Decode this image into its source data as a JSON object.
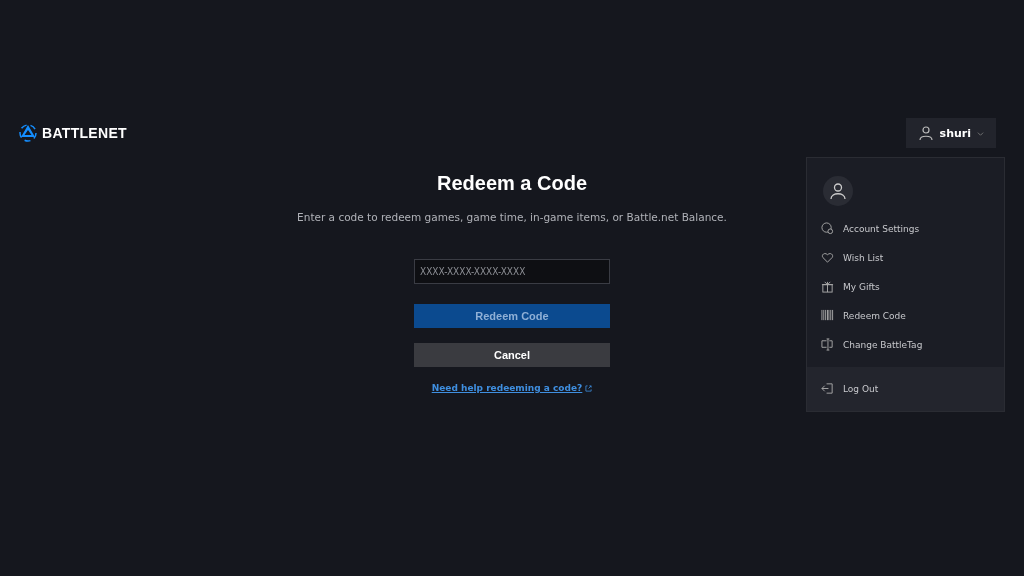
{
  "header": {
    "logo": "BATTLENET",
    "user": {
      "name": "shuri"
    }
  },
  "main": {
    "title": "Redeem a Code",
    "subtitle": "Enter a code to redeem games, game time, in-game items, or Battle.net Balance.",
    "code_field": {
      "placeholder": "XXXX-XXXX-XXXX-XXXX"
    },
    "redeem_button": {
      "label": "Redeem Code",
      "disabled": true
    },
    "cancel_button": {
      "label": "Cancel"
    },
    "help_link": "Need help redeeming a code?"
  },
  "user_menu": {
    "items": [
      {
        "label": "Account Settings",
        "kind": "settings"
      },
      {
        "label": "Wish List",
        "kind": "wishlist"
      },
      {
        "label": "My Gifts",
        "kind": "gifts"
      },
      {
        "label": "Redeem Code",
        "kind": "redeem"
      },
      {
        "label": "Change BattleTag",
        "kind": "battletag"
      }
    ],
    "footer_item": {
      "label": "Log Out"
    }
  }
}
